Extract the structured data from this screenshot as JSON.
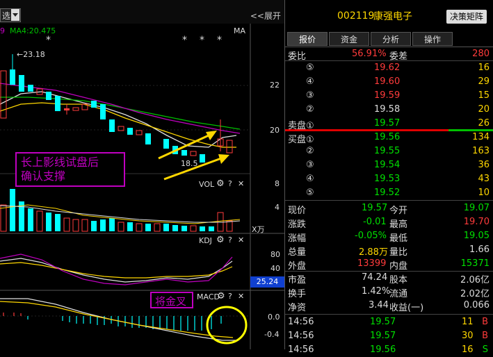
{
  "topbar": {
    "dropdown_label": "选",
    "expand_label": "<<展开",
    "ma_partial": "9",
    "ma4_label": "MA4:20.475",
    "ma_right": "MA"
  },
  "main_chart": {
    "high_label": "23.18",
    "low_label": "18.5",
    "price_ticks": [
      "22",
      "20"
    ],
    "annotation": [
      "长上影线试盘后",
      "确认支撑"
    ],
    "stars": [
      "*",
      "*",
      "*",
      "*"
    ]
  },
  "vol_panel": {
    "title": "VOL",
    "ticks": [
      "8",
      "4"
    ],
    "unit": "X万"
  },
  "kdj_panel": {
    "title": "KDJ",
    "ticks": [
      "80",
      "40"
    ],
    "current": "25.24"
  },
  "macd_panel": {
    "title": "MACD",
    "ticks": [
      "0.0",
      "-0.4"
    ],
    "annotation": "将金叉"
  },
  "panel_icons": {
    "gear": "gear-icon",
    "help": "?",
    "close": "✕"
  },
  "header": {
    "code": "002119",
    "name": "康强电子",
    "decision_button": "决策矩阵"
  },
  "tabs": [
    "报价",
    "资金",
    "分析",
    "操作"
  ],
  "weibi": {
    "label1": "委比",
    "ratio": "56.91%",
    "label2": "委差",
    "diff": "280"
  },
  "sell_orders": [
    {
      "level": "⑤",
      "price": "19.62",
      "vol": "16"
    },
    {
      "level": "④",
      "price": "19.60",
      "vol": "29"
    },
    {
      "level": "③",
      "price": "19.59",
      "vol": "15"
    },
    {
      "level": "②",
      "price": "19.58",
      "vol": "20"
    },
    {
      "level": "卖盘①",
      "price": "19.57",
      "vol": "26"
    }
  ],
  "buy_orders": [
    {
      "level": "买盘①",
      "price": "19.56",
      "vol": "134"
    },
    {
      "level": "②",
      "price": "19.55",
      "vol": "163"
    },
    {
      "level": "③",
      "price": "19.54",
      "vol": "36"
    },
    {
      "level": "④",
      "price": "19.53",
      "vol": "43"
    },
    {
      "level": "⑤",
      "price": "19.52",
      "vol": "10"
    }
  ],
  "quote": [
    {
      "l1": "现价",
      "v1": "19.57",
      "l2": "今开",
      "v2": "19.07"
    },
    {
      "l1": "涨跌",
      "v1": "-0.01",
      "l2": "最高",
      "v2": "19.70"
    },
    {
      "l1": "涨幅",
      "v1": "-0.05%",
      "l2": "最低",
      "v2": "19.05"
    },
    {
      "l1": "总量",
      "v1": "2.88万",
      "l2": "量比",
      "v2": "1.66"
    },
    {
      "l1": "外盘",
      "v1": "13399",
      "l2": "内盘",
      "v2": "15371"
    }
  ],
  "fin": [
    {
      "l1": "市盈",
      "v1": "74.24",
      "l2": "股本",
      "v2": "2.06亿"
    },
    {
      "l1": "换手",
      "v1": "1.42%",
      "l2": "流通",
      "v2": "2.02亿"
    },
    {
      "l1": "净资",
      "v1": "3.44",
      "l2": "收益(一)",
      "v2": "0.066"
    }
  ],
  "ticks": [
    {
      "time": "14:56",
      "price": "19.57",
      "vol": "11",
      "side": "B"
    },
    {
      "time": "14:56",
      "price": "19.57",
      "vol": "30",
      "side": "B"
    },
    {
      "time": "14:56",
      "price": "19.56",
      "vol": "16",
      "side": "S"
    }
  ],
  "colors": {
    "up": "#ff3b3b",
    "down": "#00ffff",
    "annotation": "#c000c0"
  }
}
